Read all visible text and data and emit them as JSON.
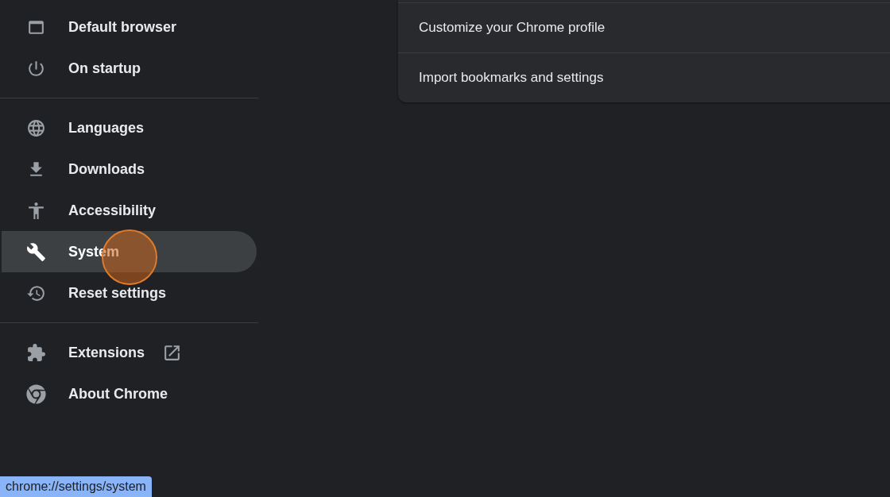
{
  "sidebar": {
    "groups": [
      {
        "items": [
          {
            "label": "Default browser",
            "selected": false
          },
          {
            "label": "On startup",
            "selected": false
          }
        ]
      },
      {
        "items": [
          {
            "label": "Languages",
            "selected": false
          },
          {
            "label": "Downloads",
            "selected": false
          },
          {
            "label": "Accessibility",
            "selected": false
          },
          {
            "label": "System",
            "selected": true
          },
          {
            "label": "Reset settings",
            "selected": false
          }
        ]
      },
      {
        "items": [
          {
            "label": "Extensions",
            "selected": false,
            "external": true
          },
          {
            "label": "About Chrome",
            "selected": false,
            "external": false
          }
        ]
      }
    ]
  },
  "card": {
    "rows": [
      "Customize your Chrome profile",
      "Import bookmarks and settings"
    ]
  },
  "status_bar": {
    "url": "chrome://settings/system"
  }
}
